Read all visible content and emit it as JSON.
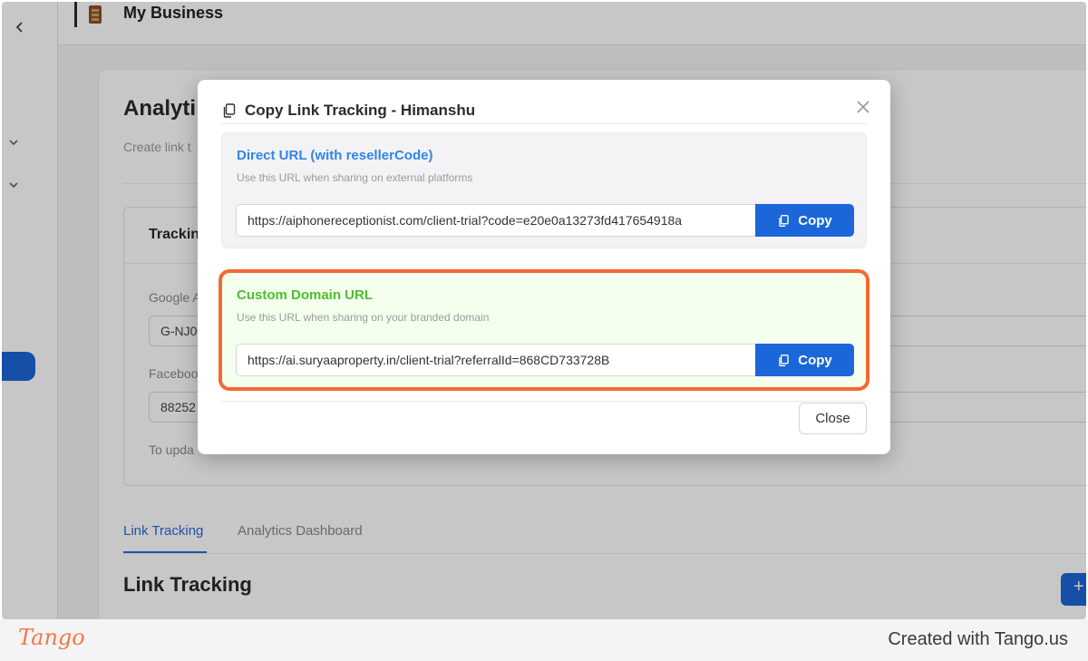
{
  "app": {
    "business_name": "My Business",
    "page_title": "Analyti",
    "page_subtitle": "Create link t",
    "tracking_card_title": "Trackin",
    "google_label": "Google A",
    "google_value": "G-NJ0",
    "facebook_label": "Faceboo",
    "facebook_value": "88252",
    "update_note": "To upda"
  },
  "tabs": [
    {
      "label": "Link Tracking",
      "active": true
    },
    {
      "label": "Analytics Dashboard",
      "active": false
    }
  ],
  "section_title": "Link Tracking",
  "add_button_label": "+",
  "modal": {
    "title": "Copy Link Tracking - Himanshu",
    "direct": {
      "title": "Direct URL (with resellerCode)",
      "description": "Use this URL when sharing on external platforms",
      "url": "https://aiphonereceptionist.com/client-trial?code=e20e0a13273fd417654918a",
      "copy_label": "Copy"
    },
    "custom": {
      "title": "Custom Domain URL",
      "description": "Use this URL when sharing on your branded domain",
      "url": "https://ai.suryaaproperty.in/client-trial?referralId=868CD733728B",
      "copy_label": "Copy"
    },
    "close_label": "Close"
  },
  "footer": {
    "logo_text": "Tango",
    "credit": "Created with Tango.us"
  },
  "colors": {
    "primary": "#1b66d8",
    "direct_title": "#2f86e6",
    "custom_title": "#4fbe2e",
    "highlight": "#f26a33",
    "tango_orange": "#f07a45"
  },
  "icons": {
    "back": "chevron-left-icon",
    "nav_expand": "chevron-down-icon",
    "modal_title": "copy-icon",
    "close": "close-icon",
    "copy": "copy-icon"
  }
}
